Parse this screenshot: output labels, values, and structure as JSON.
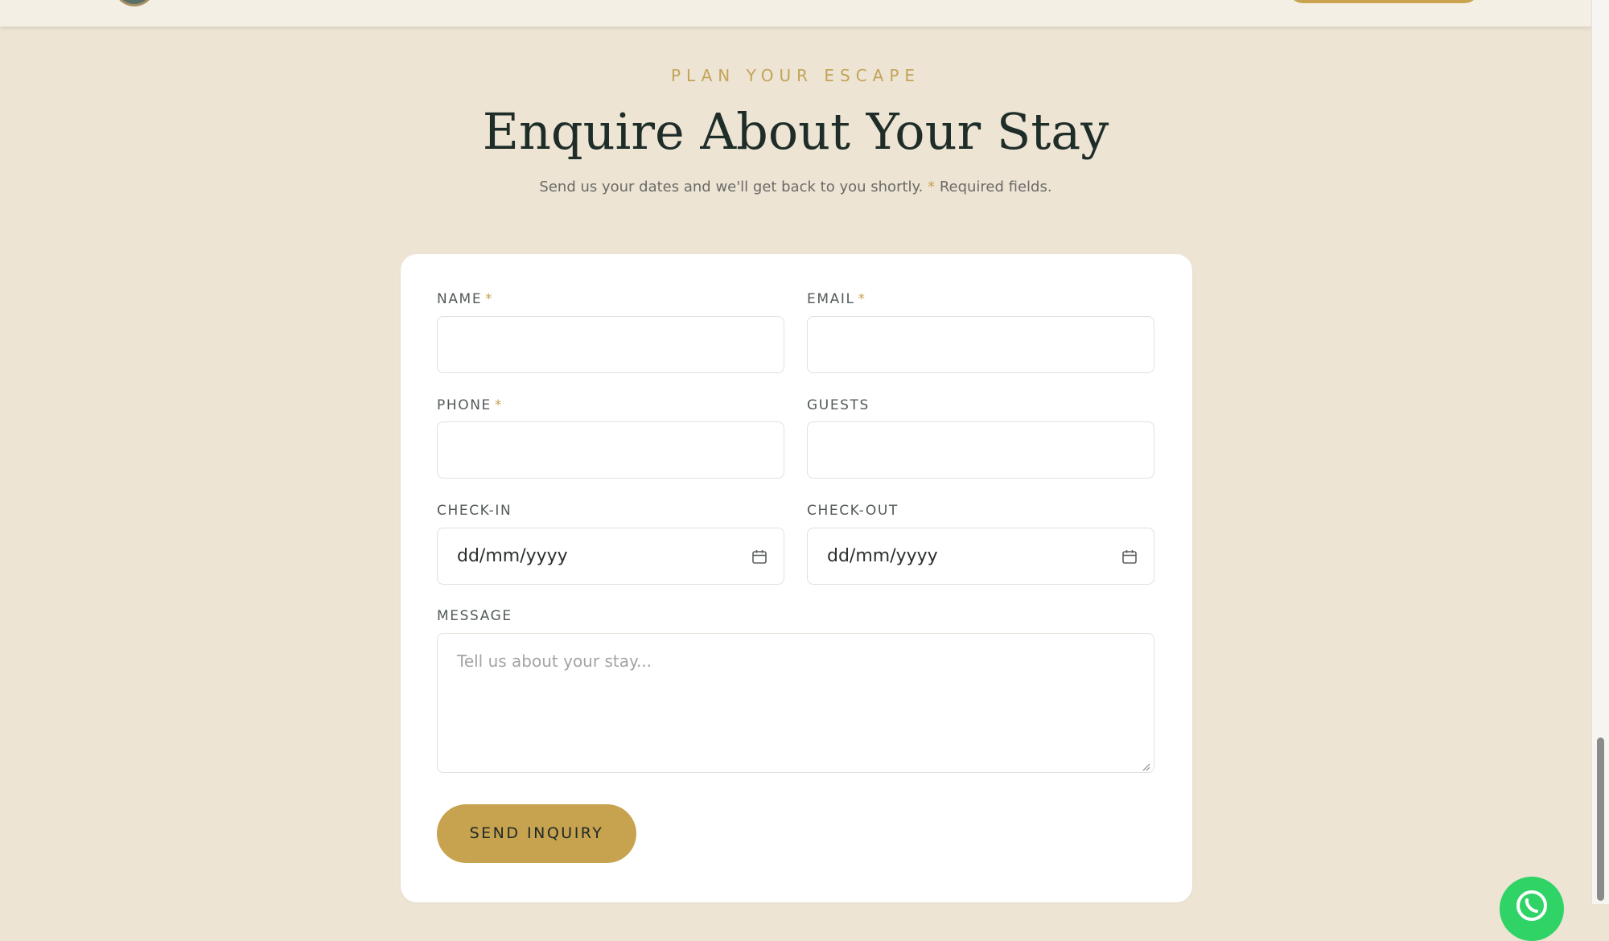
{
  "colors": {
    "page_background": "#ede4d4",
    "accent_gold": "#c9a24d",
    "heading_dark": "#1f2d29",
    "card_background": "#ffffff",
    "whatsapp_green": "#2fd366"
  },
  "section": {
    "eyebrow": "PLAN YOUR ESCAPE",
    "title": "Enquire About Your Stay",
    "subtitle_text": "Send us your dates and we'll get back to you shortly.",
    "subtitle_star": "*",
    "subtitle_required": "Required fields."
  },
  "form": {
    "name": {
      "label": "NAME",
      "required_mark": "*"
    },
    "email": {
      "label": "EMAIL",
      "required_mark": "*"
    },
    "phone": {
      "label": "PHONE",
      "required_mark": "*"
    },
    "guests": {
      "label": "GUESTS"
    },
    "check_in": {
      "label": "CHECK-IN",
      "value": "dd/mm/yyyy",
      "icon": "calendar-icon"
    },
    "check_out": {
      "label": "CHECK-OUT",
      "value": "dd/mm/yyyy",
      "icon": "calendar-icon"
    },
    "message": {
      "label": "MESSAGE",
      "placeholder": "Tell us about your stay..."
    },
    "submit_label": "SEND INQUIRY"
  },
  "floating": {
    "chat_icon": "whatsapp-icon"
  }
}
